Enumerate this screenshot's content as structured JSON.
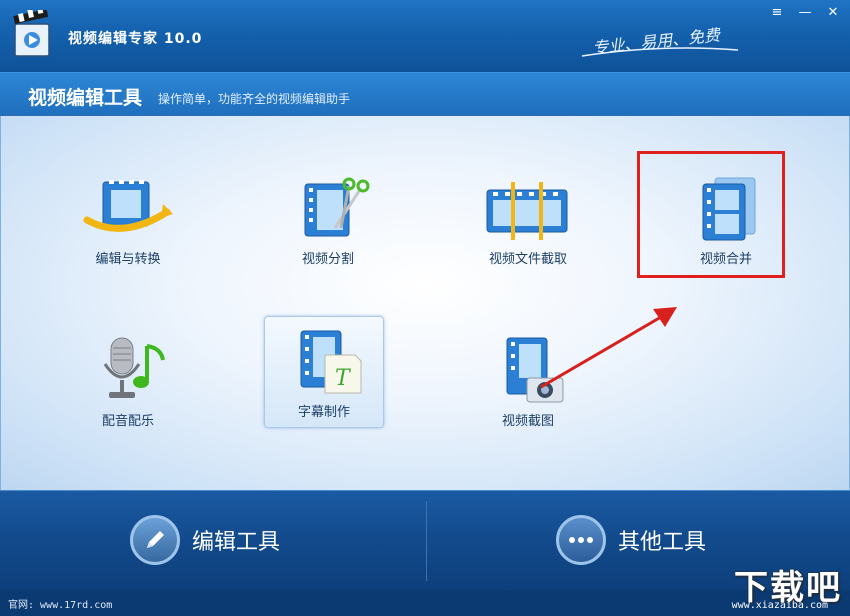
{
  "window": {
    "app_title": "视频编辑专家 10.0",
    "slogan": "专业、易用、免费",
    "buttons": {
      "menu": "≡",
      "minimize": "—",
      "close": "✕"
    }
  },
  "header": {
    "title": "视频编辑工具",
    "description": "操作简单，功能齐全的视频编辑助手"
  },
  "tools": [
    {
      "label": "编辑与转换",
      "icon": "film-convert-icon"
    },
    {
      "label": "视频分割",
      "icon": "film-scissors-icon"
    },
    {
      "label": "视频文件截取",
      "icon": "film-clip-icon"
    },
    {
      "label": "视频合并",
      "icon": "film-merge-icon"
    },
    {
      "label": "配音配乐",
      "icon": "microphone-music-icon"
    },
    {
      "label": "字幕制作",
      "icon": "film-subtitle-icon"
    },
    {
      "label": "视频截图",
      "icon": "film-camera-icon"
    }
  ],
  "footer": {
    "tabs": [
      {
        "label": "编辑工具",
        "icon": "pencil-icon",
        "active": true
      },
      {
        "label": "其他工具",
        "icon": "more-dots-icon",
        "active": false
      }
    ]
  },
  "status": {
    "site": "官网: www.17rd.com"
  },
  "watermark": {
    "main": "下载吧",
    "sub": "www.xiazaiba.com"
  },
  "colors": {
    "highlight": "#e0201d",
    "accent_blue": "#1f74c4",
    "film_blue": "#2b7fd4"
  }
}
